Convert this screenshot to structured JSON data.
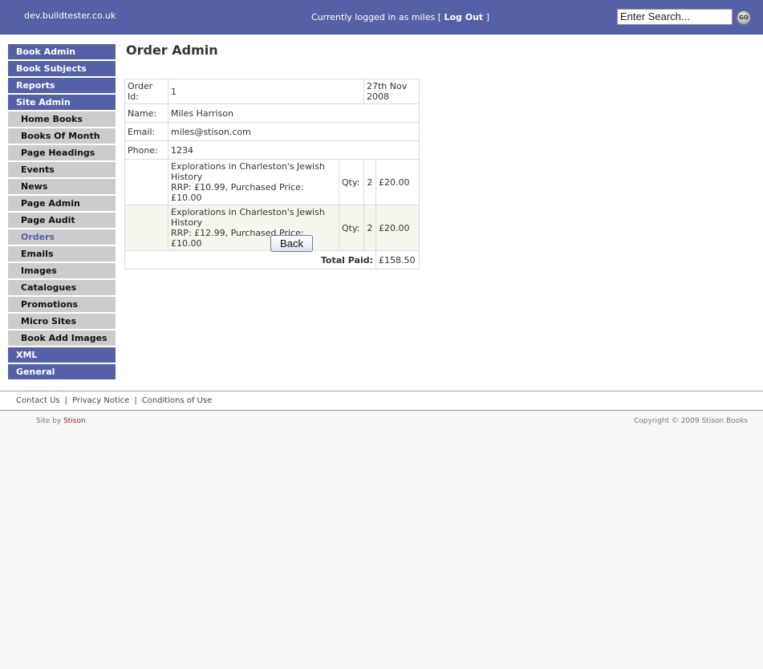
{
  "header": {
    "site_name": "dev.buildtester.co.uk",
    "login_prefix": "Currently logged in as miles [",
    "logout_label": "Log Out",
    "login_suffix": "]",
    "search_placeholder": "Enter Search...",
    "go_label": "GO"
  },
  "sidebar": {
    "items": [
      {
        "label": "Book Admin",
        "level": "top"
      },
      {
        "label": "Book Subjects",
        "level": "top"
      },
      {
        "label": "Reports",
        "level": "top"
      },
      {
        "label": "Site Admin",
        "level": "top"
      },
      {
        "label": "Home Books",
        "level": "sub"
      },
      {
        "label": "Books Of Month",
        "level": "sub"
      },
      {
        "label": "Page Headings",
        "level": "sub"
      },
      {
        "label": "Events",
        "level": "sub"
      },
      {
        "label": "News",
        "level": "sub"
      },
      {
        "label": "Page Admin",
        "level": "sub"
      },
      {
        "label": "Page Audit",
        "level": "sub"
      },
      {
        "label": "Orders",
        "level": "sub",
        "active": true
      },
      {
        "label": "Emails",
        "level": "sub"
      },
      {
        "label": "Images",
        "level": "sub"
      },
      {
        "label": "Catalogues",
        "level": "sub"
      },
      {
        "label": "Promotions",
        "level": "sub"
      },
      {
        "label": "Micro Sites",
        "level": "sub"
      },
      {
        "label": "Book Add Images",
        "level": "sub"
      },
      {
        "label": "XML",
        "level": "top"
      },
      {
        "label": "General",
        "level": "top"
      }
    ]
  },
  "main": {
    "title": "Order Admin",
    "order": {
      "id_label": "Order Id:",
      "id": "1",
      "date": "27th Nov 2008",
      "name_label": "Name:",
      "name": "Miles Harrison",
      "email_label": "Email:",
      "email": "miles@stison.com",
      "phone_label": "Phone:",
      "phone": "1234",
      "items": [
        {
          "title": "Explorations in Charleston's Jewish History",
          "price_line": "RRP: £10.99, Purchased Price: £10.00",
          "qty_label": "Qty:",
          "qty": "2",
          "total": "£20.00"
        },
        {
          "title": "Explorations in Charleston's Jewish History",
          "price_line": "RRP: £12.99, Purchased Price: £10.00",
          "qty_label": "Qty:",
          "qty": "2",
          "total": "£20.00"
        }
      ],
      "total_label": "Total Paid:",
      "total": "£158.50"
    },
    "back_label": "Back"
  },
  "footer": {
    "links": [
      "Contact Us",
      "Privacy Notice",
      "Conditions of Use"
    ],
    "separator": "|",
    "site_by_prefix": "Site by",
    "site_by_name": "Stison",
    "copyright": "Copyright © 2009 Stison Books"
  },
  "colors": {
    "brand": "#5561a7",
    "nav_sub_bg": "#cccccc",
    "alt_row_bg": "#f6f6ef"
  }
}
